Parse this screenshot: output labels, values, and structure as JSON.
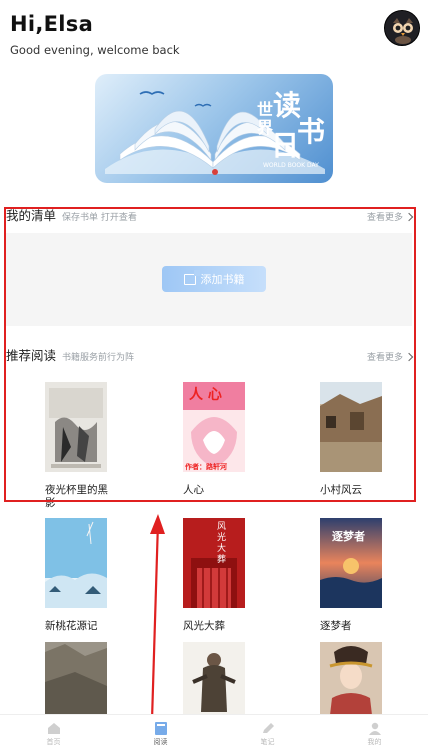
{
  "header": {
    "title": "Hi,Elsa",
    "subtitle": "Good evening, welcome back"
  },
  "banner": {
    "title_chars": [
      "世",
      "界",
      "读",
      "书",
      "日"
    ],
    "caption": "WORLD BOOK DAY"
  },
  "my_list": {
    "title": "我的清单",
    "subtitle": "保存书单 打开查看",
    "more": "查看更多",
    "add_button": "添加书籍"
  },
  "recommend": {
    "title": "推荐阅读",
    "subtitle": "书籍服务前行为阵",
    "more": "查看更多"
  },
  "books": [
    {
      "title": "夜光杯里的黑影"
    },
    {
      "title": "人心",
      "cover_title": "人 心",
      "cover_author": "作者：路轩河"
    },
    {
      "title": "小村风云"
    },
    {
      "title": "新桃花源记"
    },
    {
      "title": "风光大葬",
      "cover_title": "风光大葬"
    },
    {
      "title": "逐梦者",
      "cover_title": "逐梦者"
    },
    {
      "title": ""
    },
    {
      "title": ""
    },
    {
      "title": ""
    }
  ],
  "tabs": [
    {
      "label": "首页"
    },
    {
      "label": "阅读"
    },
    {
      "label": "笔记"
    },
    {
      "label": "我的"
    }
  ],
  "colors": {
    "highlight": "#e02020",
    "button": "#9ec7f5"
  }
}
